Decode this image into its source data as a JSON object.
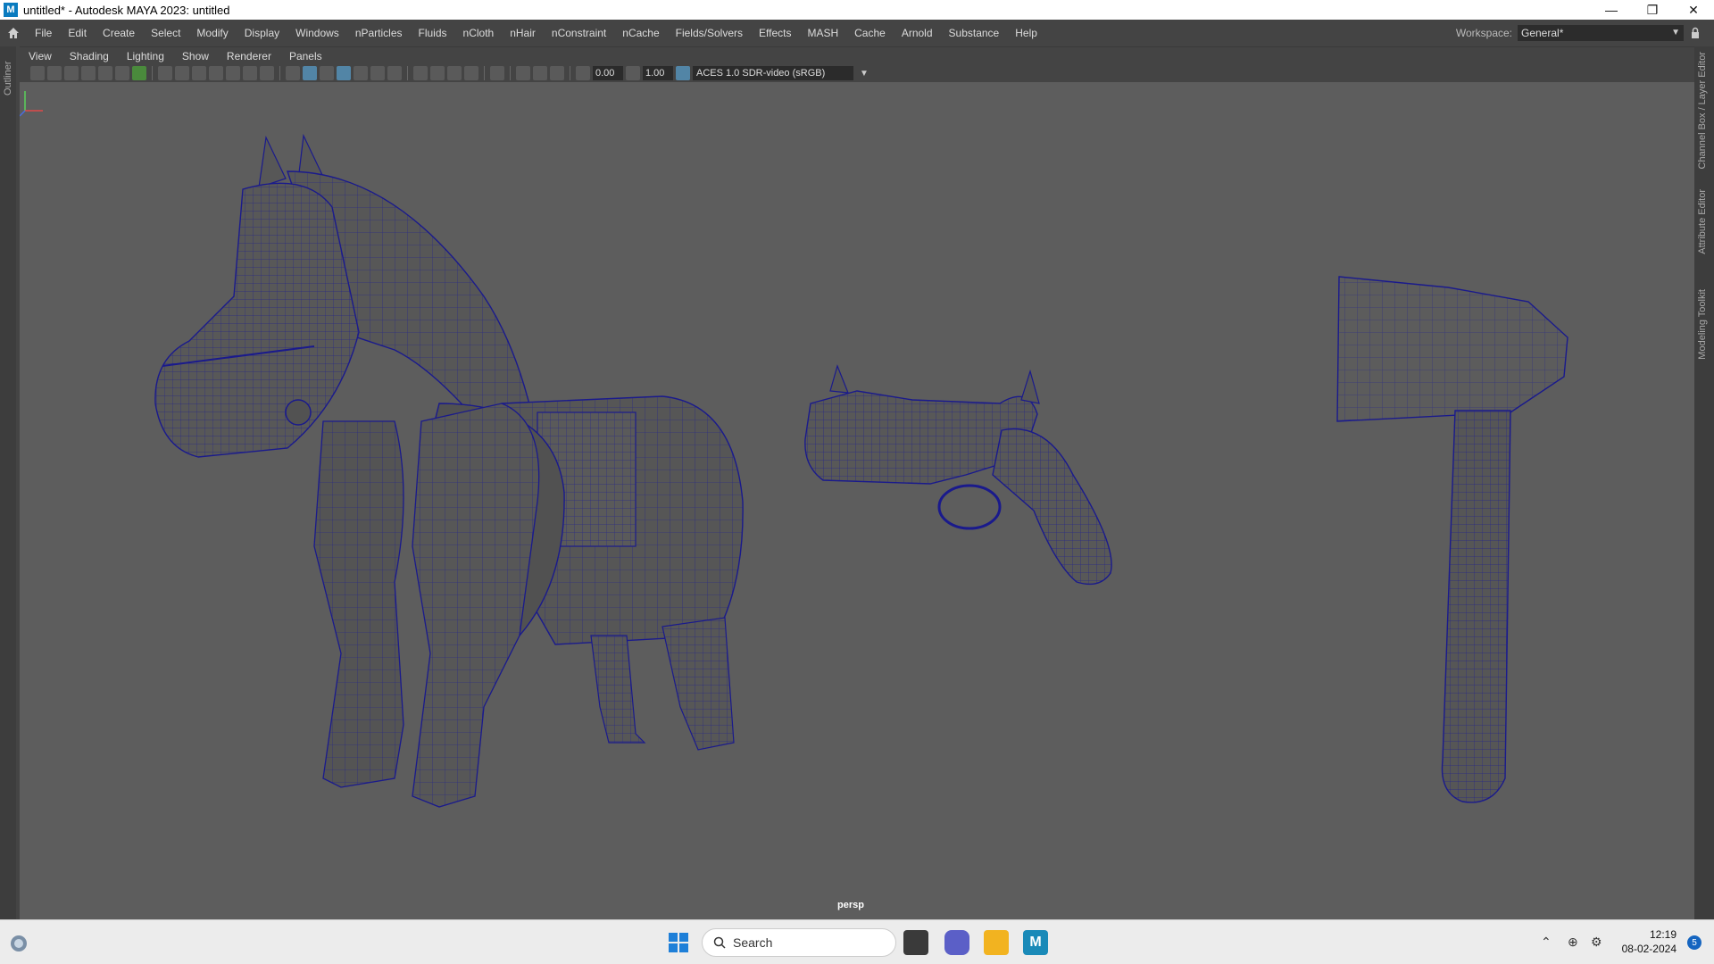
{
  "window": {
    "app_icon_letter": "M",
    "title": "untitled* - Autodesk MAYA 2023: untitled",
    "minimize": "—",
    "maximize": "❐",
    "close": "✕"
  },
  "menubar": {
    "items": [
      "File",
      "Edit",
      "Create",
      "Select",
      "Modify",
      "Display",
      "Windows",
      "nParticles",
      "Fluids",
      "nCloth",
      "nHair",
      "nConstraint",
      "nCache",
      "Fields/Solvers",
      "Effects",
      "MASH",
      "Cache",
      "Arnold",
      "Substance",
      "Help"
    ],
    "workspace_label": "Workspace:",
    "workspace_value": "General*"
  },
  "left_panel": {
    "outliner_label": "Outliner"
  },
  "right_panel": {
    "tabs": [
      "Channel Box / Layer Editor",
      "Attribute Editor",
      "Modeling Toolkit"
    ]
  },
  "panel_menu": {
    "items": [
      "View",
      "Shading",
      "Lighting",
      "Show",
      "Renderer",
      "Panels"
    ]
  },
  "toolbar": {
    "exposure": "0.00",
    "gamma": "1.00",
    "color_space": "ACES 1.0 SDR-video (sRGB)"
  },
  "viewport": {
    "camera_label": "persp",
    "background": "#5d5d5d",
    "wire_color": "#1a1a8c",
    "mesh_color": "#555555",
    "objects": [
      "horse",
      "pistol",
      "axe"
    ]
  },
  "taskbar": {
    "search_placeholder": "Search",
    "time": "12:19",
    "date": "08-02-2024",
    "notification_count": "5"
  }
}
